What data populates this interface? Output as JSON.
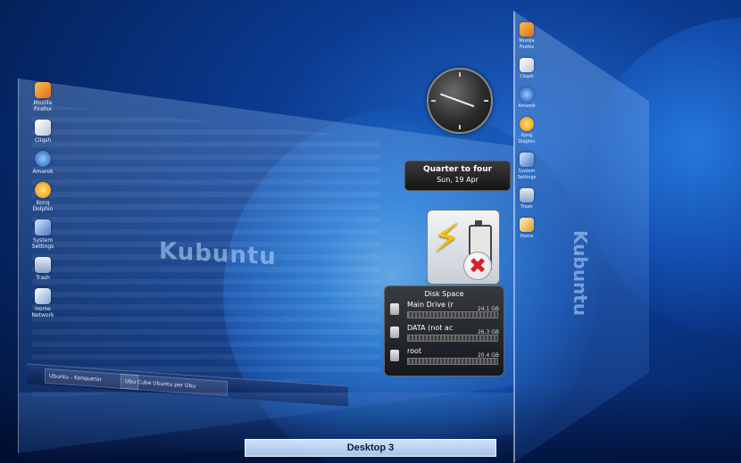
{
  "workspace": {
    "desktop_label": "Desktop 3"
  },
  "watermark": "Kubuntu",
  "widgets": {
    "clock": {
      "icon": "analog-clock-icon"
    },
    "datetime": {
      "time_text": "Quarter to four",
      "date_text": "Sun, 19 Apr"
    },
    "battery": {
      "icon": "battery-icon",
      "status_icon": "no-battery-x-icon",
      "bolt_glyph": "⚡",
      "x_glyph": "✖"
    },
    "disk_space": {
      "title": "Disk Space",
      "drives": [
        {
          "name": "Main Drive (r",
          "size": "24.1 GB"
        },
        {
          "name": "DATA (not ac",
          "size": "26.3 GB"
        },
        {
          "name": "root",
          "size": "20.4 GB"
        }
      ]
    }
  },
  "left_face": {
    "desktop_icons": [
      {
        "label": "Mozilla Firefox",
        "icon": "firefox-icon"
      },
      {
        "label": "Cliqsh",
        "icon": "document-icon"
      },
      {
        "label": "Amarok",
        "icon": "amarok-icon"
      },
      {
        "label": "Konq Dolphin",
        "icon": "dolphin-icon"
      },
      {
        "label": "System Settings",
        "icon": "settings-icon"
      },
      {
        "label": "Trash",
        "icon": "trash-icon"
      },
      {
        "label": "Home Network",
        "icon": "network-icon"
      }
    ],
    "taskbar_items": [
      "Ubuntu - Konqueror",
      "Ubu Cube Ubuntu per Ubu"
    ]
  },
  "right_face": {
    "desktop_icons": [
      {
        "label": "Mozilla Firefox",
        "icon": "firefox-icon"
      },
      {
        "label": "Cliqsh",
        "icon": "document-icon"
      },
      {
        "label": "Amarok",
        "icon": "amarok-icon"
      },
      {
        "label": "Konq Dolphin",
        "icon": "dolphin-icon"
      },
      {
        "label": "System Settings",
        "icon": "settings-icon"
      },
      {
        "label": "Trash",
        "icon": "trash-icon"
      },
      {
        "label": "Home",
        "icon": "home-icon"
      }
    ]
  }
}
